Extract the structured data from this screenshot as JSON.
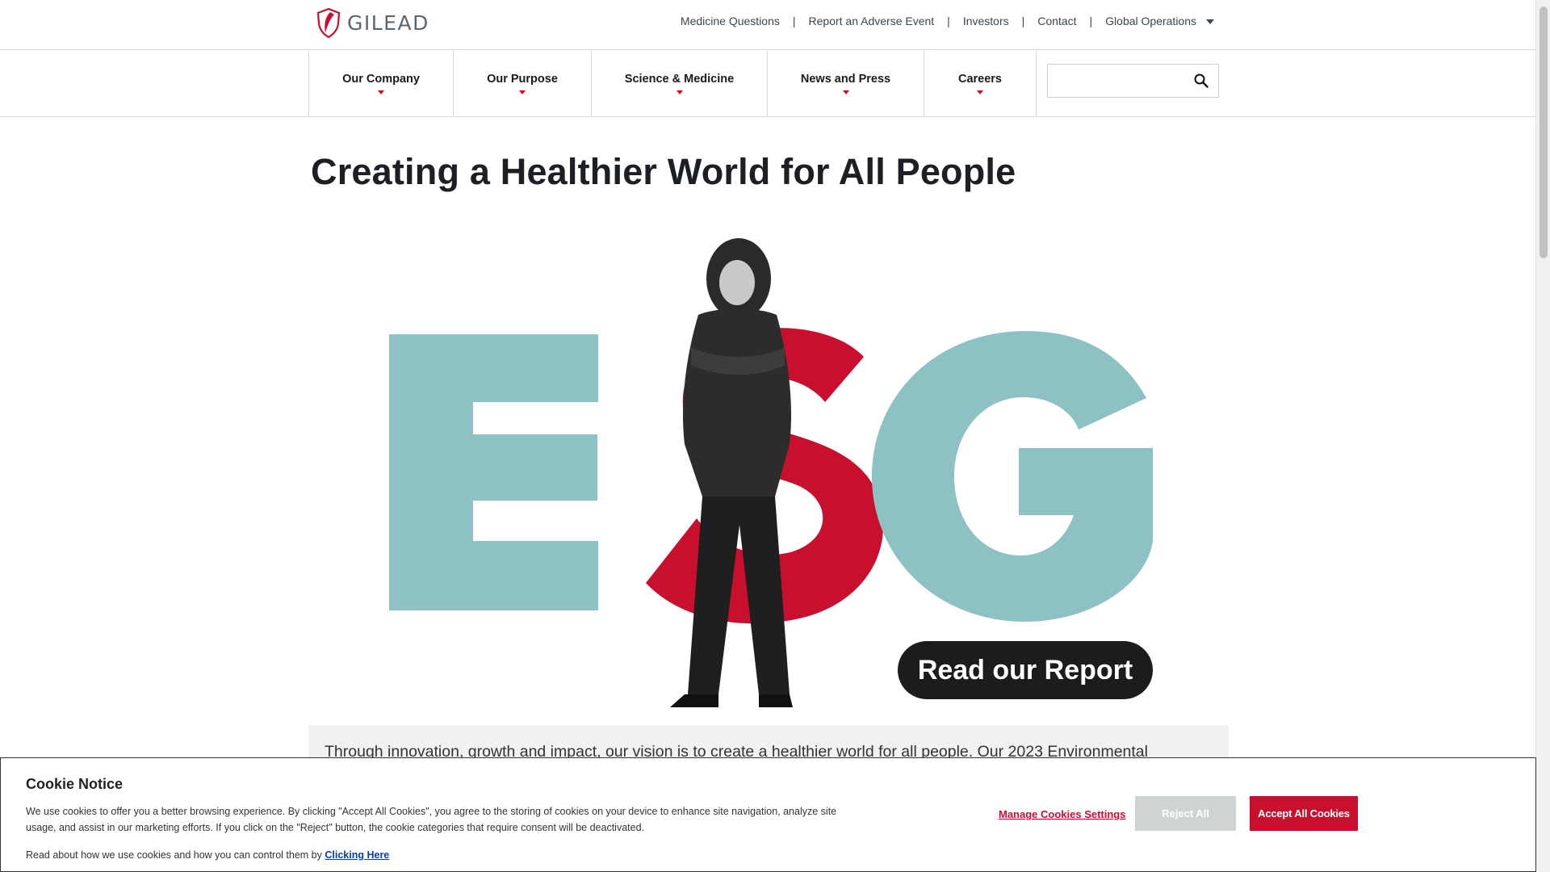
{
  "brand": {
    "logo_text": "GILEAD",
    "accent": "#c8102e",
    "teal": "#8dc1c4",
    "dark": "#1c1c1c"
  },
  "utility_nav": {
    "items": [
      {
        "label": "Medicine Questions"
      },
      {
        "label": "Report an Adverse Event"
      },
      {
        "label": "Investors"
      },
      {
        "label": "Contact"
      },
      {
        "label": "Global Operations"
      }
    ],
    "separator": "|"
  },
  "main_nav": {
    "items": [
      {
        "label": "Our Company"
      },
      {
        "label": "Our Purpose"
      },
      {
        "label": "Science & Medicine"
      },
      {
        "label": "News and Press"
      },
      {
        "label": "Careers"
      }
    ],
    "search": {
      "placeholder": "",
      "value": "",
      "icon": "search-icon"
    }
  },
  "hero": {
    "title": "Creating a Healthier World for All People",
    "art_letters": [
      "E",
      "S",
      "G"
    ],
    "cta_label": "Read our Report",
    "intro_text": "Through innovation, growth and impact, our vision is to create a healthier world for all people. Our 2023 Environmental"
  },
  "cookie": {
    "title": "Cookie Notice",
    "body": "We use cookies to offer you a better browsing experience. By clicking \"Accept All Cookies\", you agree to the storing of cookies on your device to enhance site navigation, analyze site usage, and assist in our marketing efforts. If you click on the \"Reject\" button, the cookie categories that require consent will be deactivated.",
    "more_text": "Read about how we use cookies and how you can control them by",
    "more_link": "Clicking Here",
    "manage_label": "Manage Cookies Settings",
    "reject_label": "Reject All",
    "accept_label": "Accept All Cookies"
  }
}
